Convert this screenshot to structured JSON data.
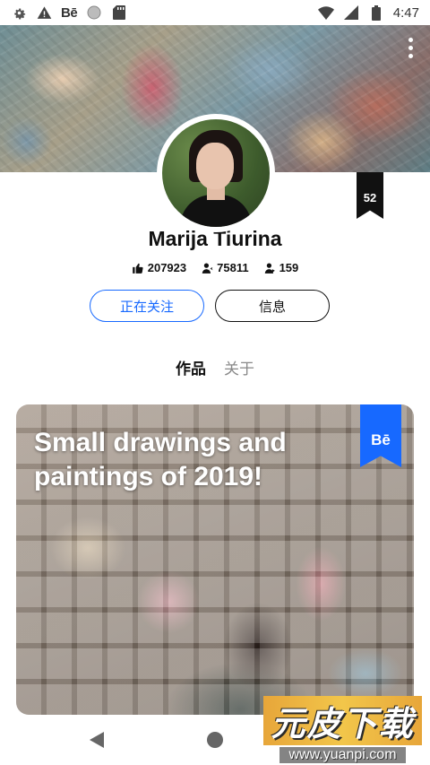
{
  "status_bar": {
    "left_icons": [
      "settings-icon",
      "warning-icon",
      "behance-icon",
      "circle-icon",
      "sdcard-icon"
    ],
    "behance_text": "Bē",
    "right_icons": [
      "wifi-icon",
      "signal-icon",
      "battery-icon"
    ],
    "time": "4:47"
  },
  "profile": {
    "name": "Marija Tiurina",
    "badge_number": "52",
    "stats": {
      "appreciations": "207923",
      "followers": "75811",
      "following": "159"
    },
    "follow_button_label": "正在关注",
    "info_button_label": "信息"
  },
  "tabs": [
    {
      "label": "作品",
      "active": true
    },
    {
      "label": "关于",
      "active": false
    }
  ],
  "project_card": {
    "title": "Small drawings and paintings of 2019!",
    "ribbon_text": "Bē"
  },
  "watermark": {
    "logo": "元皮下载",
    "url": "www.yuanpi.com"
  },
  "colors": {
    "accent": "#1769ff",
    "text": "#111111",
    "muted": "#888888"
  }
}
